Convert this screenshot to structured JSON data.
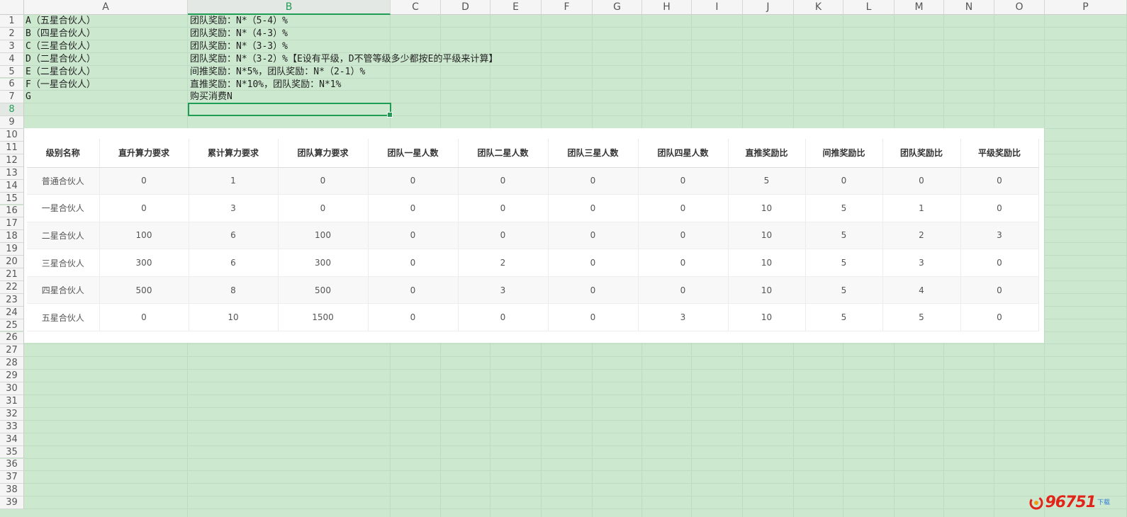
{
  "columns": [
    "A",
    "B",
    "C",
    "D",
    "E",
    "F",
    "G",
    "H",
    "I",
    "J",
    "K",
    "L",
    "M",
    "N",
    "O",
    "P"
  ],
  "active_column": "B",
  "rows": [
    "1",
    "2",
    "3",
    "4",
    "5",
    "6",
    "7",
    "8",
    "9",
    "10",
    "11",
    "12",
    "13",
    "14",
    "15",
    "16",
    "17",
    "18",
    "19",
    "20",
    "21",
    "22",
    "23",
    "24",
    "25",
    "26",
    "27",
    "28",
    "29",
    "30",
    "31",
    "32",
    "33",
    "34",
    "35",
    "36",
    "37",
    "38",
    "39"
  ],
  "active_row": "8",
  "cells": {
    "A": [
      "A（五星合伙人）",
      "B（四星合伙人）",
      "C（三星合伙人）",
      "D（二星合伙人）",
      "E（二星合伙人）",
      "F（一星合伙人）",
      "G"
    ],
    "B": [
      "团队奖励：N*（5-4）%",
      "团队奖励：N*（4-3）%",
      "团队奖励：N*（3-3）%",
      "团队奖励：N*（3-2）%【E设有平级，D不管等级多少都按E的平级来计算】",
      "间推奖励：N*5%，团队奖励：N*（2-1）%",
      "直推奖励：N*10%，团队奖励：N*1%",
      "购买消费N"
    ]
  },
  "table": {
    "headers": [
      "级别名称",
      "直升算力要求",
      "累计算力要求",
      "团队算力要求",
      "团队一星人数",
      "团队二星人数",
      "团队三星人数",
      "团队四星人数",
      "直推奖励比",
      "间推奖励比",
      "团队奖励比",
      "平级奖励比"
    ],
    "rows": [
      [
        "普通合伙人",
        "0",
        "1",
        "0",
        "0",
        "0",
        "0",
        "0",
        "5",
        "0",
        "0",
        "0"
      ],
      [
        "一星合伙人",
        "0",
        "3",
        "0",
        "0",
        "0",
        "0",
        "0",
        "10",
        "5",
        "1",
        "0"
      ],
      [
        "二星合伙人",
        "100",
        "6",
        "100",
        "0",
        "0",
        "0",
        "0",
        "10",
        "5",
        "2",
        "3"
      ],
      [
        "三星合伙人",
        "300",
        "6",
        "300",
        "0",
        "2",
        "0",
        "0",
        "10",
        "5",
        "3",
        "0"
      ],
      [
        "四星合伙人",
        "500",
        "8",
        "500",
        "0",
        "3",
        "0",
        "0",
        "10",
        "5",
        "4",
        "0"
      ],
      [
        "五星合伙人",
        "0",
        "10",
        "1500",
        "0",
        "0",
        "0",
        "3",
        "10",
        "5",
        "5",
        "0"
      ]
    ]
  },
  "watermark": {
    "number": "96751",
    "sub": "下载"
  },
  "colors": {
    "sheet_bg": "#cce8cf",
    "accent": "#1f9d55",
    "watermark": "#e2231a"
  }
}
